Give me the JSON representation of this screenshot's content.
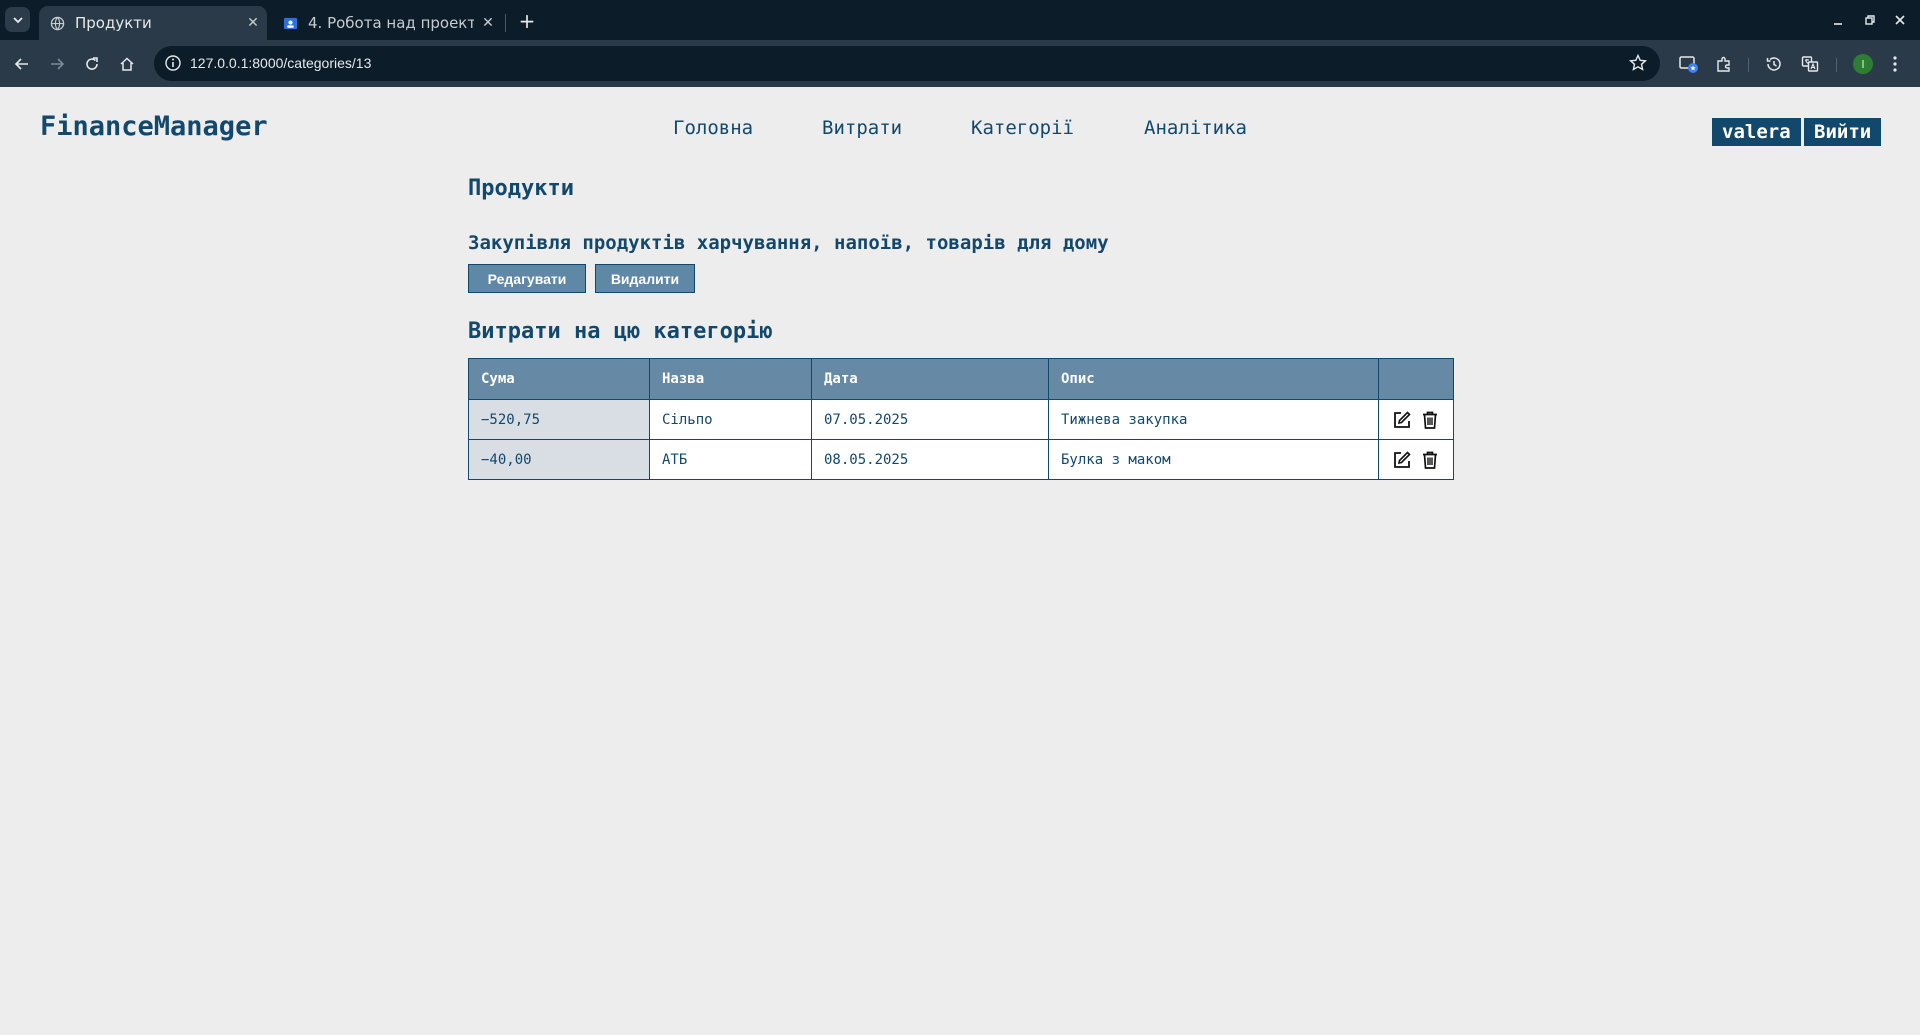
{
  "browser": {
    "tabs": [
      {
        "title": "Продукти",
        "active": true
      },
      {
        "title": "4. Робота над проектом",
        "active": false
      }
    ],
    "url": "127.0.0.1:8000/categories/13",
    "profile_initial": "I"
  },
  "app": {
    "logo": "FinanceManager",
    "nav": [
      "Головна",
      "Витрати",
      "Категорії",
      "Аналітика"
    ],
    "username": "valera",
    "logout_label": "Вийти"
  },
  "category": {
    "title": "Продукти",
    "description": "Закупівля продуктів харчування, напоїв, товарів для дому",
    "edit_label": "Редагувати",
    "delete_label": "Видалити"
  },
  "expenses": {
    "section_title": "Витрати на цю категорію",
    "columns": [
      "Сума",
      "Назва",
      "Дата",
      "Опис",
      ""
    ],
    "rows": [
      {
        "amount": "−520,75",
        "name": "Сільпо",
        "date": "07.05.2025",
        "description": "Тижнева закупка",
        "actions": [
          "edit-icon",
          "delete-icon"
        ]
      },
      {
        "amount": "−40,00",
        "name": "АТБ",
        "date": "08.05.2025",
        "description": "Булка з маком",
        "actions": [
          "edit-icon",
          "delete-icon"
        ]
      }
    ]
  },
  "colors": {
    "primary": "#13486d",
    "header_bg": "#668aa5",
    "page_bg": "#ededed"
  }
}
